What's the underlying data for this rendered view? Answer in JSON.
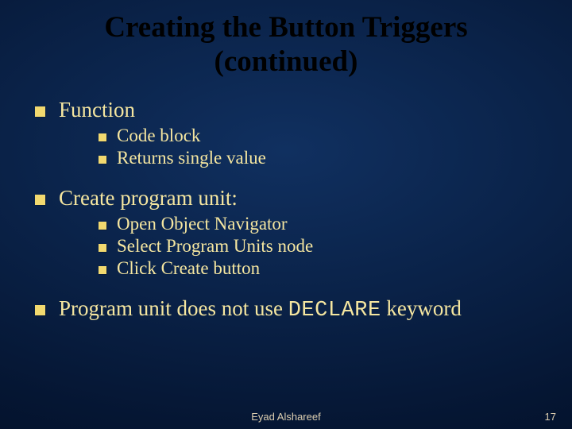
{
  "title_line1": "Creating the Button Triggers",
  "title_line2": "(continued)",
  "items": [
    {
      "label": "Function",
      "children": [
        {
          "label": "Code block"
        },
        {
          "label": "Returns single value"
        }
      ]
    },
    {
      "label": "Create program unit:",
      "children": [
        {
          "label": "Open Object Navigator"
        },
        {
          "label": "Select Program Units node"
        },
        {
          "label": "Click Create button"
        }
      ]
    }
  ],
  "last_item_pre": "Program unit does not use ",
  "last_item_code": "DECLARE",
  "last_item_post": " keyword",
  "footer_author": "Eyad Alshareef",
  "footer_page": "17"
}
